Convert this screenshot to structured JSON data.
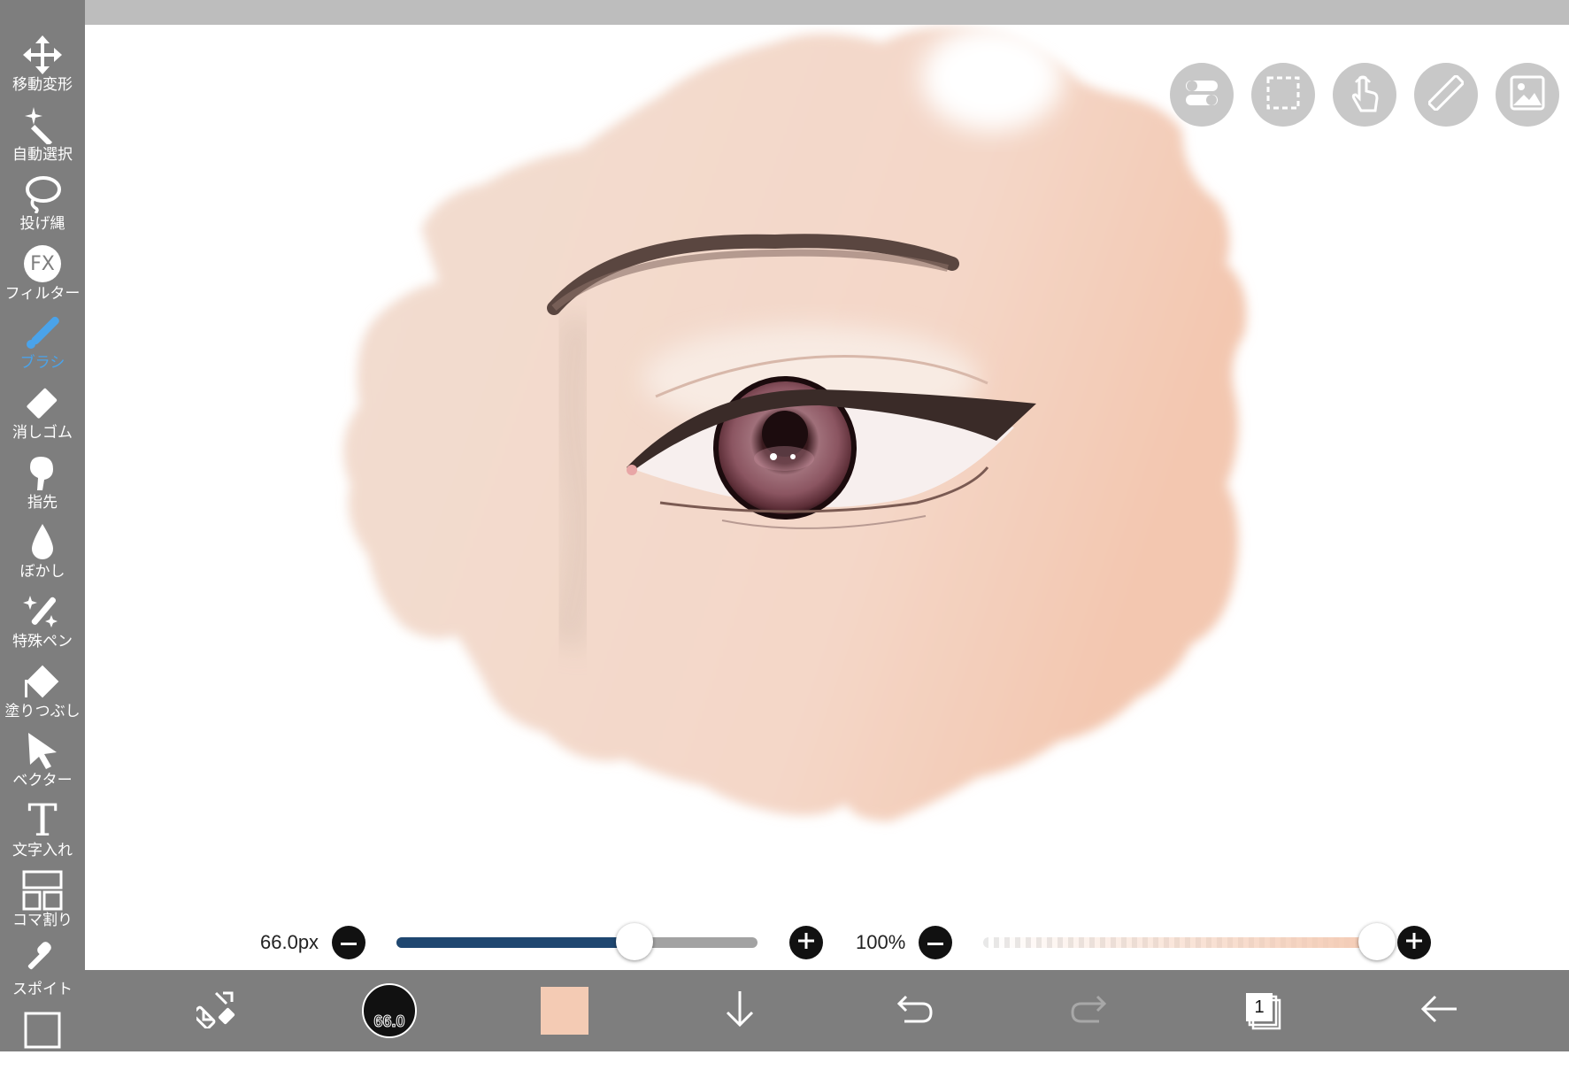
{
  "toolbar": {
    "items": [
      {
        "label": "移動変形",
        "icon": "move-icon"
      },
      {
        "label": "自動選択",
        "icon": "magic-wand-icon"
      },
      {
        "label": "投げ縄",
        "icon": "lasso-icon"
      },
      {
        "label": "フィルター",
        "icon": "fx-icon",
        "icon_text": "FX"
      },
      {
        "label": "ブラシ",
        "icon": "brush-icon",
        "active": true
      },
      {
        "label": "消しゴム",
        "icon": "eraser-icon"
      },
      {
        "label": "指先",
        "icon": "finger-icon"
      },
      {
        "label": "ぼかし",
        "icon": "blur-drop-icon"
      },
      {
        "label": "特殊ペン",
        "icon": "special-pen-icon"
      },
      {
        "label": "塗りつぶし",
        "icon": "fill-bucket-icon"
      },
      {
        "label": "ベクター",
        "icon": "vector-arrow-icon"
      },
      {
        "label": "文字入れ",
        "icon": "text-icon",
        "icon_text": "T"
      },
      {
        "label": "コマ割り",
        "icon": "panel-divide-icon"
      },
      {
        "label": "スポイト",
        "icon": "eyedropper-icon"
      }
    ]
  },
  "top_buttons": [
    "toggle-icon",
    "selection-icon",
    "touch-icon",
    "ruler-icon",
    "image-icon"
  ],
  "brush_size": {
    "label": "66.0px",
    "fraction": 0.66
  },
  "opacity": {
    "label": "100%",
    "fraction": 1.0
  },
  "bottom": {
    "brush_size_badge": "66.0",
    "current_color": "#f4cbb4",
    "layer_count": "1"
  },
  "colors": {
    "toolbar_bg": "#7e7e7e",
    "active": "#4aa3ea",
    "skin": "#f3d9cb",
    "slider_fill": "#1f4770"
  }
}
